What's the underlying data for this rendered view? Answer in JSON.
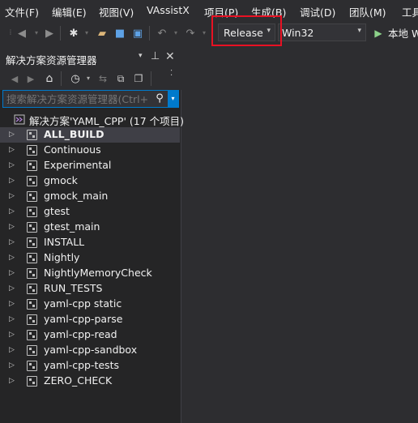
{
  "menu": [
    "文件(F)",
    "编辑(E)",
    "视图(V)",
    "VAssistX",
    "项目(P)",
    "生成(B)",
    "调试(D)",
    "团队(M)",
    "工具"
  ],
  "toolbar": {
    "configuration": "Release",
    "platform": "Win32",
    "run_label": "本地 W"
  },
  "solution_explorer": {
    "title": "解决方案资源管理器",
    "pin_glyph": "▾ ⊿",
    "search_placeholder": "搜索解决方案资源管理器(Ctrl+;)",
    "solution_label": "解决方案'YAML_CPP' (17 个项目)",
    "projects": [
      "ALL_BUILD",
      "Continuous",
      "Experimental",
      "gmock",
      "gmock_main",
      "gtest",
      "gtest_main",
      "INSTALL",
      "Nightly",
      "NightlyMemoryCheck",
      "RUN_TESTS",
      "yaml-cpp static",
      "yaml-cpp-parse",
      "yaml-cpp-read",
      "yaml-cpp-sandbox",
      "yaml-cpp-tests",
      "ZERO_CHECK"
    ],
    "selected_project": "ALL_BUILD"
  },
  "colors": {
    "highlight_box": "#e81123",
    "accent": "#007acc",
    "run_green": "#8dd28a"
  }
}
